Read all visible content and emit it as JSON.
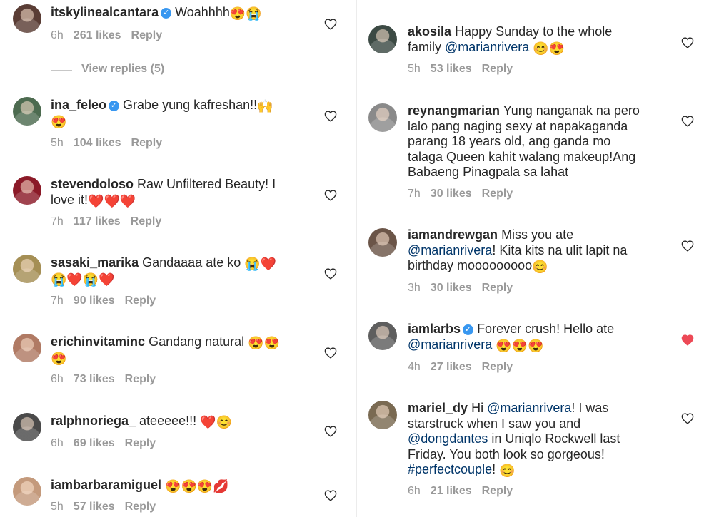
{
  "left": [
    {
      "username": "itskylinealcantara",
      "verified": true,
      "text": [
        {
          "t": "Woahhhh"
        },
        {
          "e": "😍"
        },
        {
          "e": "😭"
        }
      ],
      "time": "6h",
      "likes": "261 likes",
      "reply": "Reply",
      "view_replies": "View replies (5)",
      "liked": false,
      "avatar": "#5a3d35"
    },
    {
      "username": "ina_feleo",
      "verified": true,
      "text": [
        {
          "t": "Grabe yung kafreshan!!"
        },
        {
          "e": "🙌"
        },
        {
          "br": true
        },
        {
          "e": "😍"
        }
      ],
      "time": "5h",
      "likes": "104 likes",
      "reply": "Reply",
      "liked": false,
      "avatar": "#4d6b50"
    },
    {
      "username": "stevendoloso",
      "verified": false,
      "text": [
        {
          "t": "Raw Unfiltered Beauty! I"
        },
        {
          "br": true
        },
        {
          "t": "love it!"
        },
        {
          "e": "❤️"
        },
        {
          "e": "❤️"
        },
        {
          "e": "❤️"
        }
      ],
      "time": "7h",
      "likes": "117 likes",
      "reply": "Reply",
      "liked": false,
      "avatar": "#8b1a28"
    },
    {
      "username": "sasaki_marika",
      "verified": false,
      "text": [
        {
          "t": "Gandaaaa ate ko "
        },
        {
          "e": "😭"
        },
        {
          "e": "❤️"
        },
        {
          "br": true
        },
        {
          "e": "😭"
        },
        {
          "e": "❤️"
        },
        {
          "e": "😭"
        },
        {
          "e": "❤️"
        }
      ],
      "time": "7h",
      "likes": "90 likes",
      "reply": "Reply",
      "liked": false,
      "avatar": "#a58f55"
    },
    {
      "username": "erichinvitaminc",
      "verified": false,
      "text": [
        {
          "t": "Gandang natural "
        },
        {
          "e": "😍"
        },
        {
          "e": "😍"
        },
        {
          "br": true
        },
        {
          "e": "😍"
        }
      ],
      "time": "6h",
      "likes": "73 likes",
      "reply": "Reply",
      "liked": false,
      "avatar": "#b07a64"
    },
    {
      "username": "ralphnoriega_",
      "verified": false,
      "text": [
        {
          "t": "ateeeee!!! "
        },
        {
          "e": "❤️"
        },
        {
          "e": "😊"
        }
      ],
      "time": "6h",
      "likes": "69 likes",
      "reply": "Reply",
      "liked": false,
      "avatar": "#4a4a4a"
    },
    {
      "username": "iambarbaramiguel",
      "verified": false,
      "text": [
        {
          "t": ""
        },
        {
          "e": "😍"
        },
        {
          "e": "😍"
        },
        {
          "e": "😍"
        },
        {
          "e": "💋"
        }
      ],
      "time": "5h",
      "likes": "57 likes",
      "reply": "Reply",
      "liked": false,
      "avatar": "#c49a7c"
    }
  ],
  "right": [
    {
      "username": "akosila",
      "verified": false,
      "text": [
        {
          "t": "Happy Sunday to the whole"
        },
        {
          "br": true
        },
        {
          "t": "family "
        },
        {
          "m": "@marianrivera"
        },
        {
          "t": " "
        },
        {
          "e": "😊"
        },
        {
          "e": "😍"
        }
      ],
      "time": "5h",
      "likes": "53 likes",
      "reply": "Reply",
      "liked": false,
      "avatar": "#3c4a44"
    },
    {
      "username": "reynangmarian",
      "verified": false,
      "text": [
        {
          "t": "Yung nanganak na pero"
        },
        {
          "br": true
        },
        {
          "t": "lalo pang naging sexy at napakaganda"
        },
        {
          "br": true
        },
        {
          "t": "parang 18 years old, ang ganda mo"
        },
        {
          "br": true
        },
        {
          "t": "talaga Queen kahit walang makeup!Ang"
        },
        {
          "br": true
        },
        {
          "t": "Babaeng Pinagpala sa lahat"
        }
      ],
      "time": "7h",
      "likes": "30 likes",
      "reply": "Reply",
      "liked": false,
      "avatar": "#8a8a8a"
    },
    {
      "username": "iamandrewgan",
      "verified": false,
      "text": [
        {
          "t": "Miss you ate"
        },
        {
          "br": true
        },
        {
          "m": "@marianrivera"
        },
        {
          "t": "! Kita kits na ulit lapit na"
        },
        {
          "br": true
        },
        {
          "t": "birthday mooooooooo"
        },
        {
          "e": "😊"
        }
      ],
      "time": "3h",
      "likes": "30 likes",
      "reply": "Reply",
      "liked": false,
      "avatar": "#6b5548"
    },
    {
      "username": "iamlarbs",
      "verified": true,
      "text": [
        {
          "t": "Forever crush! Hello ate"
        },
        {
          "br": true
        },
        {
          "m": "@marianrivera"
        },
        {
          "t": " "
        },
        {
          "e": "😍"
        },
        {
          "e": "😍"
        },
        {
          "e": "😍"
        }
      ],
      "time": "4h",
      "likes": "27 likes",
      "reply": "Reply",
      "liked": true,
      "avatar": "#5e5e5e"
    },
    {
      "username": "mariel_dy",
      "verified": false,
      "text": [
        {
          "t": "Hi "
        },
        {
          "m": "@marianrivera"
        },
        {
          "t": "! I was"
        },
        {
          "br": true
        },
        {
          "t": "starstruck when I saw you and"
        },
        {
          "br": true
        },
        {
          "m": "@dongdantes"
        },
        {
          "t": " in Uniqlo Rockwell last"
        },
        {
          "br": true
        },
        {
          "t": "Friday. You both look so gorgeous!"
        },
        {
          "br": true
        },
        {
          "m": "#perfectcouple"
        },
        {
          "t": "! "
        },
        {
          "e": "😊"
        }
      ],
      "time": "6h",
      "likes": "21 likes",
      "reply": "Reply",
      "liked": false,
      "avatar": "#7a6a52"
    }
  ],
  "colors": {
    "text": "#262626",
    "meta": "#999999",
    "mention": "#003569",
    "liked_heart": "#ed4956",
    "verified": "#3897f0"
  },
  "icons": {
    "like": "heart-icon",
    "verified": "verified-badge-icon"
  }
}
